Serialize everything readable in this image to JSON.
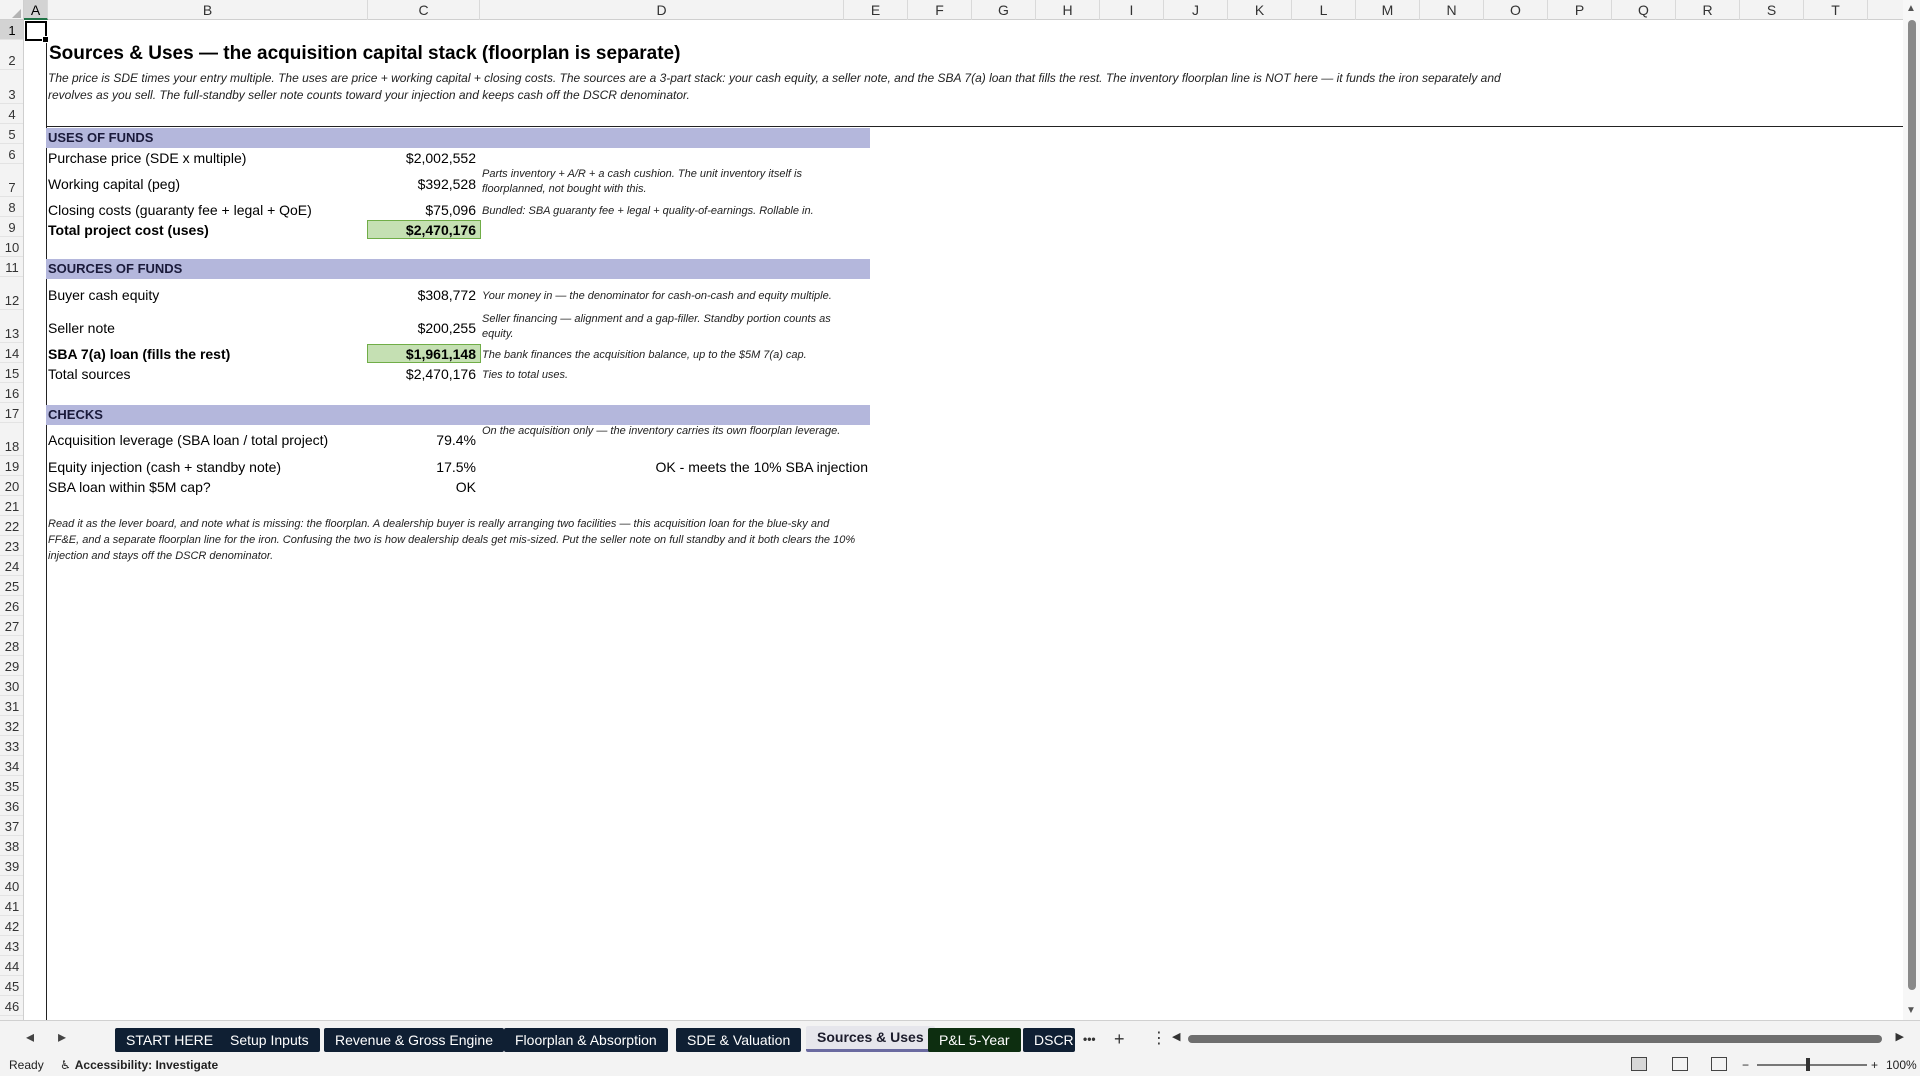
{
  "columns": [
    "A",
    "B",
    "C",
    "D",
    "E",
    "F",
    "G",
    "H",
    "I",
    "J",
    "K",
    "L",
    "M",
    "N",
    "O",
    "P",
    "Q",
    "R",
    "S",
    "T"
  ],
  "rows": [
    "1",
    "2",
    "3",
    "4",
    "5",
    "6",
    "7",
    "8",
    "9",
    "10",
    "11",
    "12",
    "13",
    "14",
    "15",
    "16",
    "17",
    "18",
    "19",
    "20",
    "21",
    "22",
    "23",
    "24",
    "25",
    "26",
    "27",
    "28",
    "29",
    "30",
    "31",
    "32",
    "33",
    "34",
    "35",
    "36",
    "37",
    "38",
    "39",
    "40",
    "41",
    "42",
    "43",
    "44",
    "45",
    "46"
  ],
  "sheet": {
    "title": "Sources & Uses — the acquisition capital stack (floorplan is separate)",
    "intro": "The price is SDE times your entry multiple. The uses are price + working capital + closing costs. The sources are a 3-part stack: your cash equity, a seller note, and the SBA 7(a) loan that fills the rest. The inventory floorplan line is NOT here — it funds the iron separately and revolves as you sell. The full-standby seller note counts toward your injection and keeps cash off the DSCR denominator.",
    "uses": {
      "header": "USES OF FUNDS",
      "purchase_label": "Purchase price (SDE x multiple)",
      "purchase_value": "$2,002,552",
      "wc_label": "Working capital (peg)",
      "wc_value": "$392,528",
      "wc_note": "Parts inventory + A/R + a cash cushion. The unit inventory itself is floorplanned, not bought with this.",
      "closing_label": "Closing costs (guaranty fee + legal + QoE)",
      "closing_value": "$75,096",
      "closing_note": "Bundled: SBA guaranty fee + legal + quality-of-earnings. Rollable in.",
      "total_label": "Total project cost (uses)",
      "total_value": "$2,470,176"
    },
    "sources": {
      "header": "SOURCES OF FUNDS",
      "equity_label": "Buyer cash equity",
      "equity_value": "$308,772",
      "equity_note": "Your money in — the denominator for cash-on-cash and equity multiple.",
      "seller_label": "Seller note",
      "seller_value": "$200,255",
      "seller_note": "Seller financing — alignment and a gap-filler. Standby portion counts as equity.",
      "sba_label": "SBA 7(a) loan (fills the rest)",
      "sba_value": "$1,961,148",
      "sba_note": "The bank finances the acquisition balance, up to the $5M 7(a) cap.",
      "total_label": "Total sources",
      "total_value": "$2,470,176",
      "total_note": "Ties to total uses."
    },
    "checks": {
      "header": "CHECKS",
      "leverage_label": "Acquisition leverage (SBA loan / total project)",
      "leverage_value": "79.4%",
      "leverage_note": "On the acquisition only — the inventory carries its own floorplan leverage.",
      "injection_label": "Equity injection (cash + standby note)",
      "injection_value": "17.5%",
      "injection_status": "OK - meets the 10% SBA injection",
      "cap_label": "SBA loan within $5M cap?",
      "cap_value": "OK"
    },
    "footer_note": "Read it as the lever board, and note what is missing: the floorplan. A dealership buyer is really arranging two facilities — this acquisition loan for the blue-sky and FF&E, and a separate floorplan line for the iron. Confusing the two is how dealership deals get mis-sized. Put the seller note on full standby and it both clears the 10% injection and stays off the DSCR denominator."
  },
  "tabs": [
    {
      "label": "START HERE",
      "style": "dark"
    },
    {
      "label": "Setup Inputs",
      "style": "dark"
    },
    {
      "label": "Revenue & Gross Engine",
      "style": "dark"
    },
    {
      "label": "Floorplan & Absorption",
      "style": "dark"
    },
    {
      "label": "SDE & Valuation",
      "style": "dark"
    },
    {
      "label": "Sources & Uses",
      "style": "active"
    },
    {
      "label": "P&L 5-Year",
      "style": "green"
    },
    {
      "label": "DSCR &",
      "style": "dark"
    }
  ],
  "status": {
    "ready": "Ready",
    "accessibility": "Accessibility: Investigate",
    "zoom": "100%"
  },
  "icons": {
    "prev": "◂",
    "next": "▸",
    "more": "•••",
    "add": "+",
    "menu": "⋮"
  }
}
